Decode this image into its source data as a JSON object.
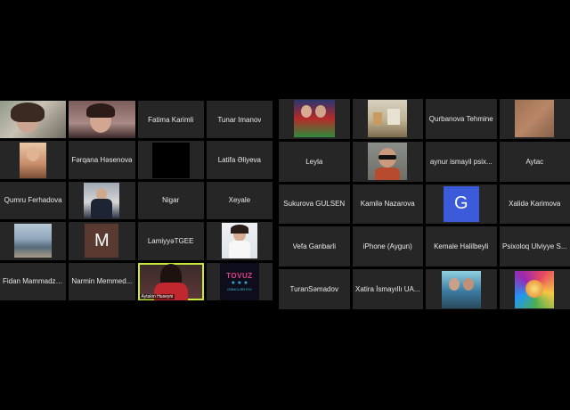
{
  "left_grid": {
    "tiles": [
      {
        "type": "video",
        "name": ""
      },
      {
        "type": "video",
        "name": ""
      },
      {
        "type": "name",
        "name": "Fatima Karimli"
      },
      {
        "type": "name",
        "name": "Tunar Imanov"
      },
      {
        "type": "thumb",
        "name": ""
      },
      {
        "type": "name",
        "name": "Fərqana Həsenova"
      },
      {
        "type": "blackbox",
        "name": ""
      },
      {
        "type": "name",
        "name": "Latifa Əliyeva"
      },
      {
        "type": "name",
        "name": "Qumru Ferhadova"
      },
      {
        "type": "thumb",
        "name": ""
      },
      {
        "type": "name",
        "name": "Nigar"
      },
      {
        "type": "name",
        "name": "Xeyale"
      },
      {
        "type": "thumb",
        "name": ""
      },
      {
        "type": "initial",
        "name": "M"
      },
      {
        "type": "name",
        "name": "LamiyyəTGEE"
      },
      {
        "type": "thumb",
        "name": ""
      },
      {
        "type": "name",
        "name": "Fidan Mammadza..."
      },
      {
        "type": "name",
        "name": "Narmin Memmed..."
      },
      {
        "type": "active",
        "name": "Aytakin Huseyni"
      },
      {
        "type": "logo",
        "name": "GƏNCLƏR EVİ"
      }
    ],
    "logo_title": "TOVUZ"
  },
  "right_grid": {
    "tiles": [
      {
        "type": "thumb",
        "name": ""
      },
      {
        "type": "thumb",
        "name": ""
      },
      {
        "type": "name",
        "name": "Qurbanova Tehmine"
      },
      {
        "type": "thumb",
        "name": ""
      },
      {
        "type": "name",
        "name": "Leyla"
      },
      {
        "type": "thumb",
        "name": ""
      },
      {
        "type": "name",
        "name": "aynur ismayil psix..."
      },
      {
        "type": "name",
        "name": "Aytac"
      },
      {
        "type": "name",
        "name": "Sukurova GULSEN"
      },
      {
        "type": "name",
        "name": "Kamilə Nazarova"
      },
      {
        "type": "initial",
        "name": "G"
      },
      {
        "type": "name",
        "name": "Xalidə Karimova"
      },
      {
        "type": "name",
        "name": "Vefa Ganbarli"
      },
      {
        "type": "name",
        "name": "iPhone (Aygun)"
      },
      {
        "type": "name",
        "name": "Kemale Halilbeyli"
      },
      {
        "type": "name",
        "name": "Psixoloq Ulviyye S..."
      },
      {
        "type": "name",
        "name": "TuranSəmadov"
      },
      {
        "type": "name",
        "name": "Xatira İsmayıllı UA..."
      },
      {
        "type": "thumb",
        "name": ""
      },
      {
        "type": "thumb",
        "name": ""
      }
    ]
  },
  "colors": {
    "tile_bg": "#262626",
    "active_border": "#c8e83a",
    "initial_g": "#3b5bdb",
    "initial_m": "#5a3a30"
  }
}
